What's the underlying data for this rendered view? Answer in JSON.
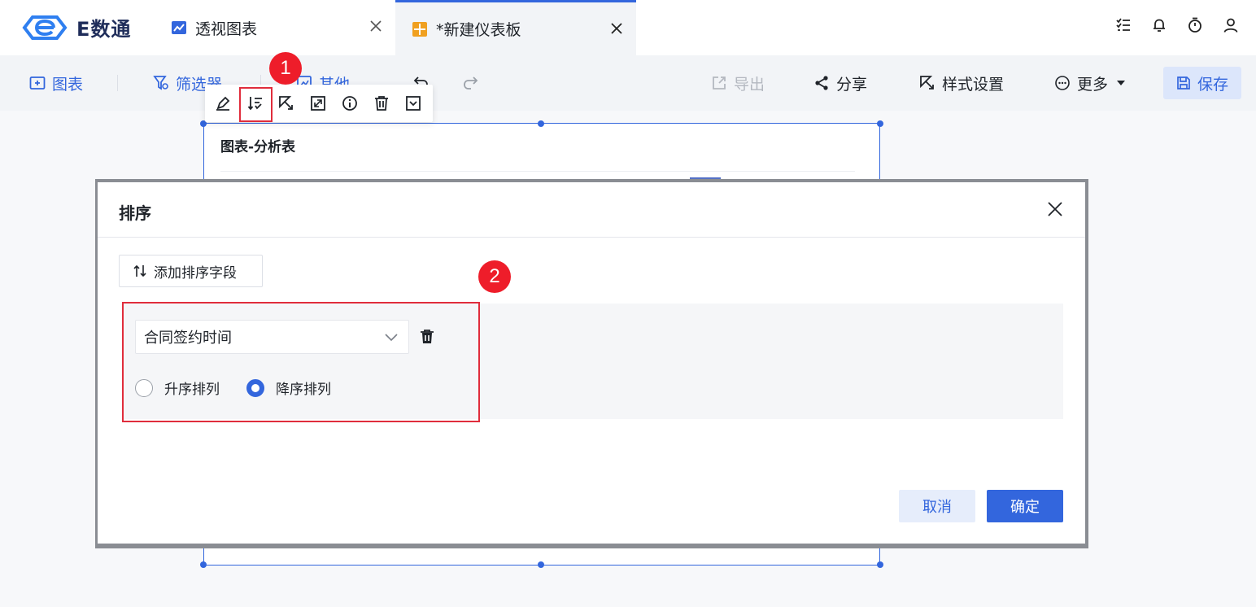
{
  "app": {
    "logo_text": "E数通"
  },
  "tabs": [
    {
      "label": "透视图表",
      "active": false
    },
    {
      "label": "*新建仪表板",
      "active": true
    }
  ],
  "topbar_icons": [
    "task-list-icon",
    "bell-icon",
    "timer-icon",
    "user-icon"
  ],
  "toolbar": {
    "chart_label": "图表",
    "filter_label": "筛选器",
    "other_label": "其他",
    "export_label": "导出",
    "share_label": "分享",
    "style_label": "样式设置",
    "more_label": "更多",
    "save_label": "保存"
  },
  "widget": {
    "title": "图表-分析表",
    "action_icons": [
      "edit-icon",
      "sort-icon",
      "style-icon",
      "expand-icon",
      "info-icon",
      "delete-icon",
      "collapse-icon"
    ]
  },
  "badges": {
    "step1": "1",
    "step2": "2"
  },
  "modal": {
    "title": "排序",
    "add_field_label": "添加排序字段",
    "sort_field": "合同签约时间",
    "asc_label": "升序排列",
    "desc_label": "降序排列",
    "selected_order": "desc",
    "cancel_label": "取消",
    "ok_label": "确定"
  },
  "colors": {
    "accent": "#3366dd",
    "highlight": "#e02d3c",
    "badge": "#ee1d2a",
    "logo": "#2f7ff0"
  }
}
